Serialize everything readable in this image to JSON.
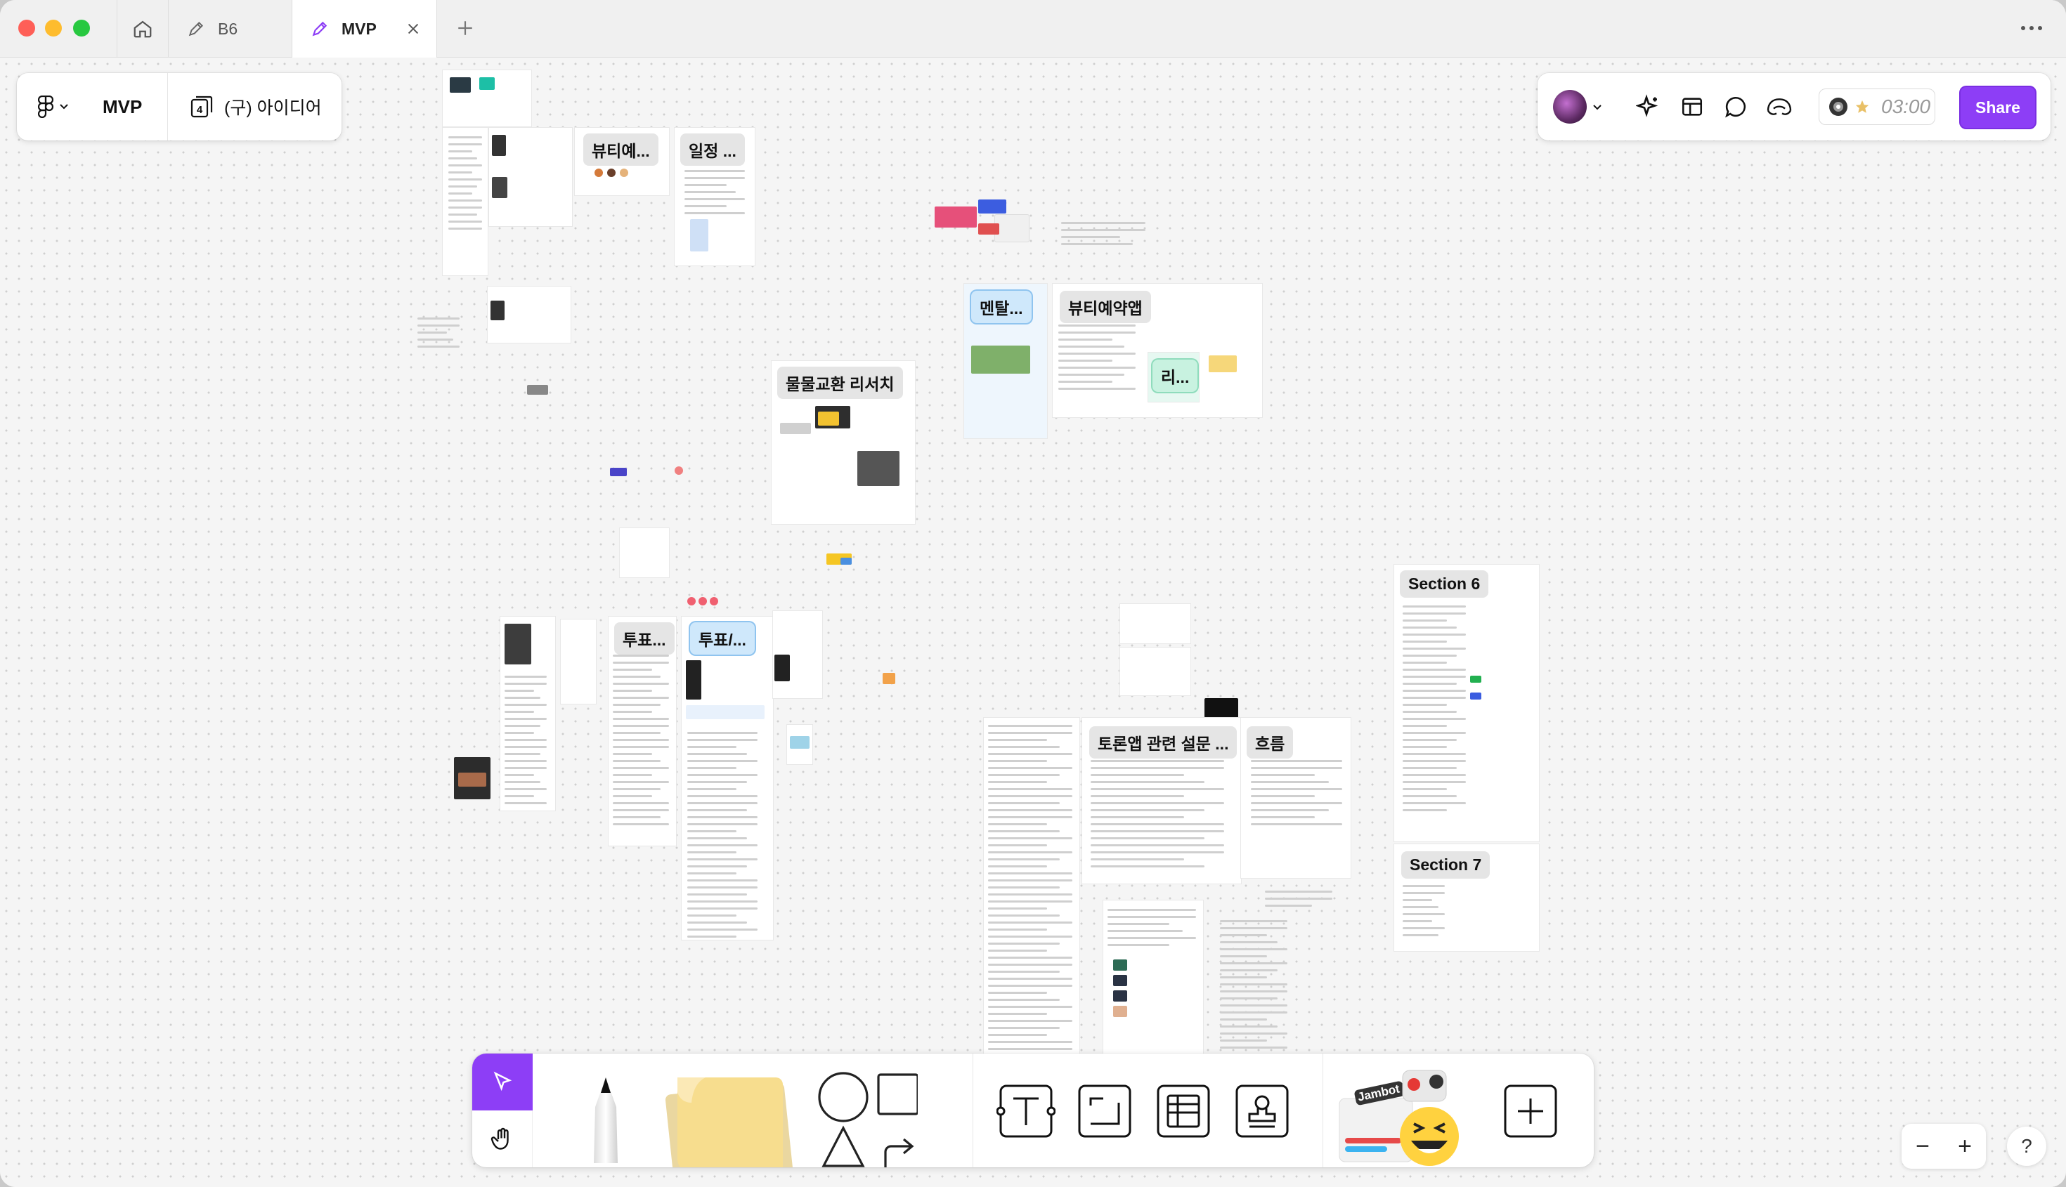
{
  "tabs": {
    "b6": "B6",
    "mvp": "MVP"
  },
  "file": {
    "name": "MVP",
    "page_count": "4",
    "page_name": "(구) 아이디어"
  },
  "header": {
    "timer": "03:00",
    "share_label": "Share"
  },
  "canvas_labels": {
    "beauty": "뷰티예...",
    "schedule": "일정 ...",
    "mental": "멘탈...",
    "beauty_app": "뷰티예약앱",
    "ri": "리...",
    "barter": "물물교환 리서치",
    "vote1": "투표...",
    "vote2": "투표/...",
    "debate": "토론앱 관련 설문 ...",
    "flow": "흐름",
    "section6": "Section 6",
    "section7": "Section 7"
  },
  "toolbar": {
    "jambot": "Jambot"
  },
  "zoom": {
    "minus": "−",
    "plus": "+"
  },
  "help": "?",
  "colors": {
    "accent": "#8d3ef6",
    "close": "#fe5f57",
    "minimize": "#febc2e",
    "maximize": "#28c840"
  }
}
